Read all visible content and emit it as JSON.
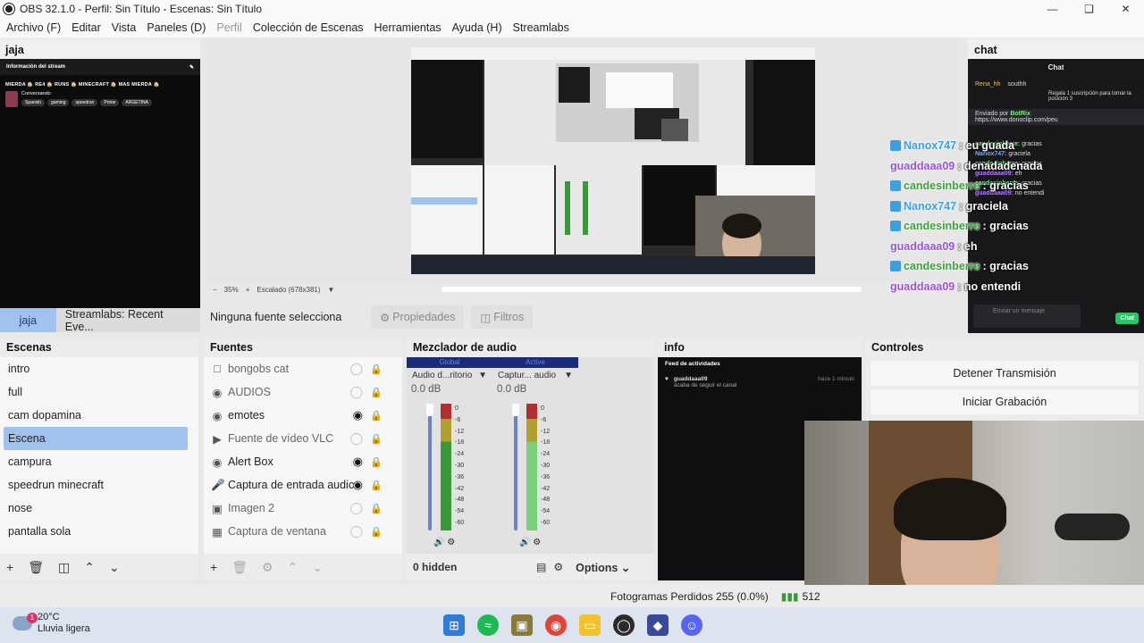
{
  "window": {
    "title": "OBS 32.1.0 - Perfil: Sin Título - Escenas: Sin Título"
  },
  "menu": [
    "Archivo (F)",
    "Editar",
    "Vista",
    "Paneles (D)",
    "Perfil",
    "Colección de Escenas",
    "Herramientas",
    "Ayuda (H)",
    "Streamlabs"
  ],
  "left_dock": {
    "title": "jaja",
    "stream_info_label": "Información del stream",
    "stream_title": "MIERDA 🏠 RE4 🏠 RUNS 🏠 MINECRAFT 🏠 MAS MIERDA 🏠",
    "category": "Conversando",
    "tags": [
      "Spanish",
      "gaming",
      "speedrun",
      "Prime",
      "ARGETINA"
    ]
  },
  "dock_tabs": [
    "jaja",
    "Streamlabs: Recent Eve..."
  ],
  "preview": {
    "zoom": "35%",
    "scaling": "Escalado (678x381)"
  },
  "source_bar": {
    "no_source": "Ninguna fuente selecciona",
    "properties": "Propiedades",
    "filters": "Filtros"
  },
  "chat_dock": {
    "title": "chat",
    "header": "Chat",
    "top_user": "Rena_hh",
    "top_user2": "southh",
    "gift_text": "Regala 1 suscripción para tomar la posición 3",
    "sent_by": "Enviado por",
    "bot": "BotRix",
    "link": "https://www.donoclip.com/peu",
    "messages": [
      {
        "user": "candesinberre:",
        "text": "gracias"
      },
      {
        "user": "Nanox747:",
        "text": "graciela"
      },
      {
        "user": "candesinberre:",
        "text": "gracias"
      },
      {
        "user": "guaddaaa09:",
        "text": "eh"
      },
      {
        "user": "candesinberre:",
        "text": "gracias"
      },
      {
        "user": "guaddaaa09:",
        "text": "no entendi"
      }
    ],
    "input_placeholder": "Enviar un mensaje",
    "send_label": "Chat"
  },
  "overlay_chat": [
    {
      "user": "Nanox747",
      "msg": ": eu",
      "extra": "guada",
      "type": "t"
    },
    {
      "user": "guaddaaa09",
      "msg": ": denadadenada",
      "type": "p"
    },
    {
      "user": "candesinberre",
      "msg": ": gracias",
      "type": "g"
    },
    {
      "user": "Nanox747",
      "msg": ": graciela",
      "type": "t"
    },
    {
      "user": "candesinberre",
      "msg": ": gracias",
      "type": "g"
    },
    {
      "user": "guaddaaa09",
      "msg": ": eh",
      "type": "p"
    },
    {
      "user": "candesinberre",
      "msg": ": gracias",
      "type": "g"
    },
    {
      "user": "guaddaaa09",
      "msg": ": no entendi",
      "type": "p"
    }
  ],
  "scenes": {
    "title": "Escenas",
    "items": [
      "intro",
      "full",
      "cam dopamina",
      "Escena",
      "campura",
      "speedrun minecraft",
      "nose",
      "pantalla sola"
    ],
    "active_index": 3
  },
  "sources": {
    "title": "Fuentes",
    "items": [
      {
        "name": "bongobs cat",
        "icon": "browser-icon",
        "visible": false
      },
      {
        "name": "AUDIOS",
        "icon": "browser-icon",
        "visible": false
      },
      {
        "name": "emotes",
        "icon": "browser-icon",
        "visible": true
      },
      {
        "name": "Fuente de vídeo VLC",
        "icon": "play-icon",
        "visible": false
      },
      {
        "name": "Alert Box",
        "icon": "browser-icon",
        "visible": true
      },
      {
        "name": "Captura de entrada audic",
        "icon": "mic-icon",
        "visible": true
      },
      {
        "name": "Imagen 2",
        "icon": "image-icon",
        "visible": false
      },
      {
        "name": "Captura de ventana",
        "icon": "window-icon",
        "visible": false
      }
    ]
  },
  "mixer": {
    "title": "Mezclador de audio",
    "channels": [
      {
        "state": "Global",
        "name": "Audio d...ritorio",
        "db": "0.0 dB"
      },
      {
        "state": "Active",
        "name": "Captur... audio",
        "db": "0.0 dB"
      }
    ],
    "scale": [
      "0",
      "-6",
      "-12",
      "-18",
      "-24",
      "-30",
      "-36",
      "-42",
      "-48",
      "-54",
      "-60"
    ],
    "hidden": "0 hidden",
    "options": "Options"
  },
  "info": {
    "title": "info",
    "feed_title": "Feed de actividades",
    "item_user": "guaddaaa09",
    "item_text": "acaba de seguir el canal",
    "item_time": "hace 1 minuto"
  },
  "controls": {
    "title": "Controles",
    "stop_stream": "Detener Transmisión",
    "start_record": "Iniciar Grabación"
  },
  "status": {
    "dropped": "Fotogramas Perdidos 255 (0.0%)",
    "rate": "512"
  },
  "taskbar": {
    "temp": "20°C",
    "weather": "Lluvia ligera",
    "badge": "1"
  },
  "colors": {
    "accent": "#9fc2ef",
    "active_scene_text": "#1d3e70",
    "meter_green": "#3a9a3a",
    "meter_red": "#b03030"
  }
}
